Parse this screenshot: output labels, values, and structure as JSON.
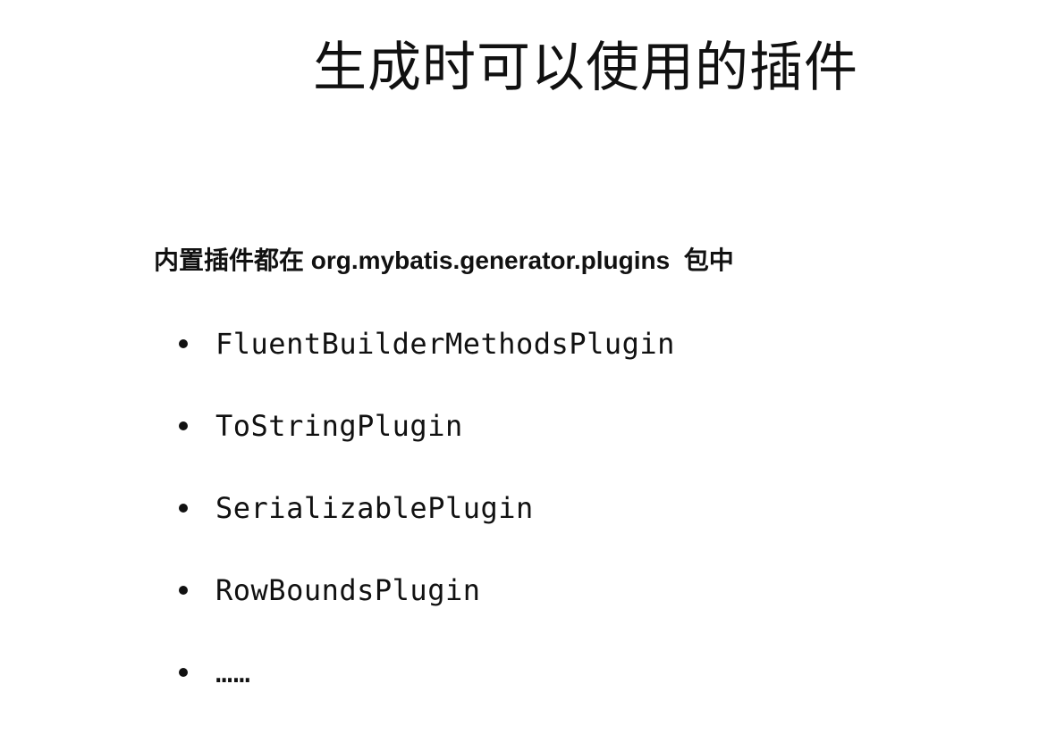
{
  "slide": {
    "title": "生成时可以使用的插件",
    "intro": {
      "prefix": "内置插件都在",
      "package": "org.mybatis.generator.plugins",
      "suffix": "包中"
    },
    "bullets": [
      "FluentBuilderMethodsPlugin",
      "ToStringPlugin",
      "SerializablePlugin",
      "RowBoundsPlugin",
      "……"
    ]
  }
}
